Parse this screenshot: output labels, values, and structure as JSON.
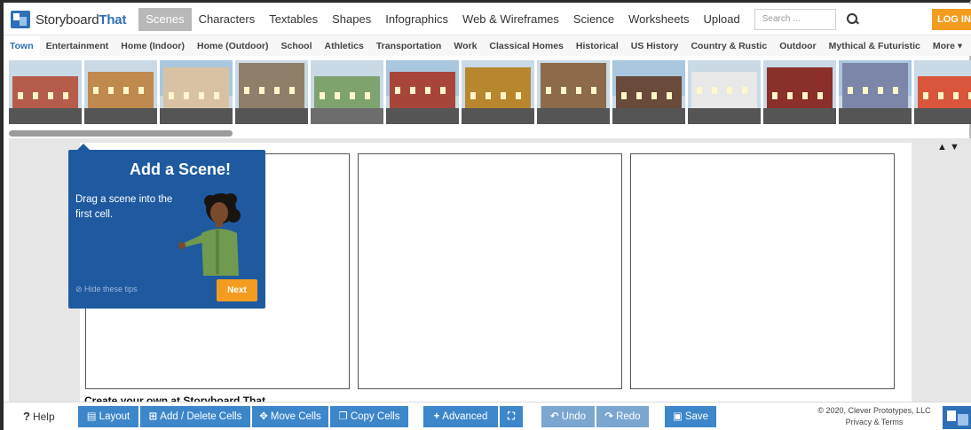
{
  "app": {
    "logo_prefix": "Storyboard",
    "logo_suffix": "That",
    "login": "LOG IN"
  },
  "nav": {
    "items": [
      "Scenes",
      "Characters",
      "Textables",
      "Shapes",
      "Infographics",
      "Web & Wireframes",
      "Science",
      "Worksheets",
      "Upload"
    ],
    "search_placeholder": "Search ..."
  },
  "categories": [
    "Town",
    "Entertainment",
    "Home (Indoor)",
    "Home (Outdoor)",
    "School",
    "Athletics",
    "Transportation",
    "Work",
    "Classical Homes",
    "Historical",
    "US History",
    "Country & Rustic",
    "Outdoor",
    "Mythical & Futuristic",
    "More ▾"
  ],
  "scene_colors": [
    "#b65c4a",
    "#c08a4e",
    "#d9c2a4",
    "#8f7f6a",
    "#7fa36f",
    "#a8453a",
    "#b8862f",
    "#8c6a4a",
    "#6a4a3a",
    "#e8e8e8",
    "#8a2f2a",
    "#7b86a8",
    "#d9553b",
    "#cfcfcf"
  ],
  "workspace": {
    "arrows": "▲ ▼",
    "credit": "Create your own at Storyboard That"
  },
  "tip": {
    "title": "Add a Scene!",
    "body": "Drag a scene into the first cell.",
    "hide": "⊘ Hide these tips",
    "next": "Next"
  },
  "toolbar": {
    "help": "Help",
    "layout": "Layout",
    "add_delete": "Add / Delete Cells",
    "move": "Move Cells",
    "copy": "Copy Cells",
    "advanced": "Advanced",
    "undo": "Undo",
    "redo": "Redo",
    "save": "Save",
    "copyright": "© 2020, Clever Prototypes, LLC",
    "privacy": "Privacy & Terms"
  },
  "colors": {
    "brand": "#2f6fb5",
    "accent": "#f39c1f",
    "tip_bg": "#1f5aa0",
    "button": "#3d86c9"
  }
}
